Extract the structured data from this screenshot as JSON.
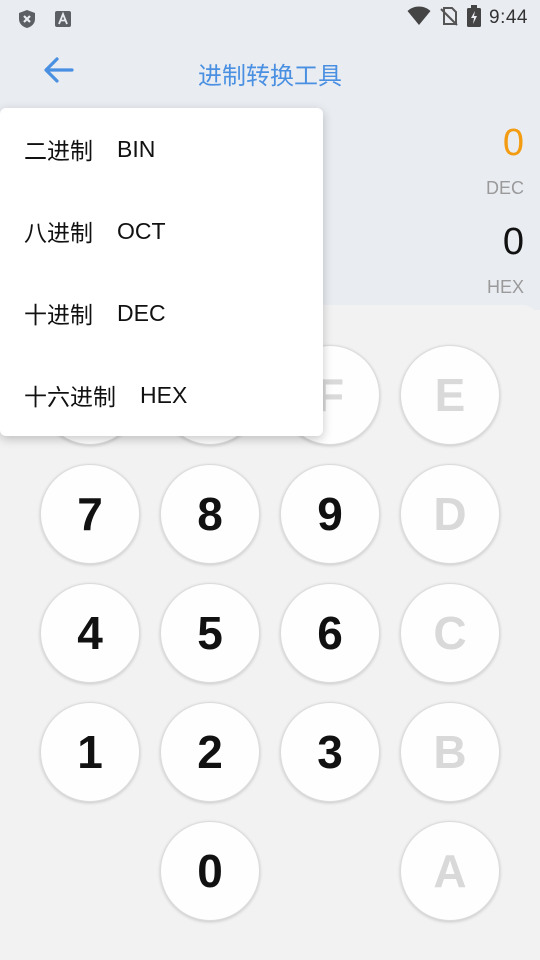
{
  "status_bar": {
    "time": "9:44",
    "icons": [
      "shield-x-icon",
      "text-a-icon",
      "wifi-icon",
      "no-sim-icon",
      "battery-charging-icon"
    ]
  },
  "app_bar": {
    "title": "进制转换工具",
    "back_icon": "arrow-left-icon",
    "accent_color": "#4a90e2"
  },
  "results": [
    {
      "value": "0",
      "label": "DEC",
      "color": "#f39c12"
    },
    {
      "value": "0",
      "label": "HEX",
      "color": "#111111"
    }
  ],
  "menu": {
    "items": [
      {
        "name": "二进制",
        "code": "BIN"
      },
      {
        "name": "八进制",
        "code": "OCT"
      },
      {
        "name": "十进制",
        "code": "DEC"
      },
      {
        "name": "十六进制",
        "code": "HEX"
      }
    ]
  },
  "keypad": {
    "rows": [
      [
        "",
        "",
        "F",
        "E"
      ],
      [
        "7",
        "8",
        "9",
        "D"
      ],
      [
        "4",
        "5",
        "6",
        "C"
      ],
      [
        "1",
        "2",
        "3",
        "B"
      ],
      [
        "",
        "0",
        "",
        "A"
      ]
    ],
    "disabled_keys": [
      "F",
      "E",
      "D",
      "C",
      "B",
      "A"
    ]
  }
}
